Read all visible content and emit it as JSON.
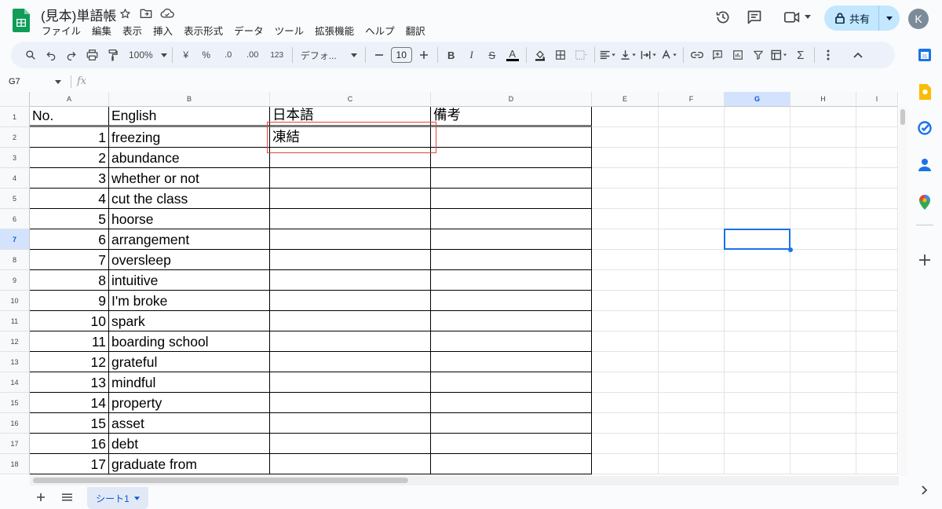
{
  "doc": {
    "title": "(見本)単語帳"
  },
  "menu": [
    "ファイル",
    "編集",
    "表示",
    "挿入",
    "表示形式",
    "データ",
    "ツール",
    "拡張機能",
    "ヘルプ",
    "翻訳"
  ],
  "header": {
    "share_label": "共有",
    "avatar_letter": "K"
  },
  "toolbar": {
    "zoom": "100%",
    "currency": "¥",
    "percent": "%",
    "dec_decrease": ".0",
    "dec_increase": ".00",
    "number_format": "123",
    "font": "デフォ...",
    "font_size": "10"
  },
  "formula_bar": {
    "cell_ref": "G7",
    "fx": "fx",
    "content": ""
  },
  "grid": {
    "columns": [
      "A",
      "B",
      "C",
      "D",
      "E",
      "F",
      "G",
      "H",
      "I"
    ],
    "selected_column": "G",
    "selected_row": "7",
    "rows": [
      {
        "row": "1",
        "a": "No.",
        "b": "English",
        "c": "日本語",
        "d": "備考"
      },
      {
        "row": "2",
        "a": "1",
        "b": "freezing",
        "c": "凍結",
        "d": ""
      },
      {
        "row": "3",
        "a": "2",
        "b": "abundance",
        "c": "",
        "d": ""
      },
      {
        "row": "4",
        "a": "3",
        "b": "whether or not",
        "c": "",
        "d": ""
      },
      {
        "row": "5",
        "a": "4",
        "b": "cut the class",
        "c": "",
        "d": ""
      },
      {
        "row": "6",
        "a": "5",
        "b": "hoorse",
        "c": "",
        "d": ""
      },
      {
        "row": "7",
        "a": "6",
        "b": "arrangement",
        "c": "",
        "d": ""
      },
      {
        "row": "8",
        "a": "7",
        "b": "oversleep",
        "c": "",
        "d": ""
      },
      {
        "row": "9",
        "a": "8",
        "b": "intuitive",
        "c": "",
        "d": ""
      },
      {
        "row": "10",
        "a": "9",
        "b": "I'm broke",
        "c": "",
        "d": ""
      },
      {
        "row": "11",
        "a": "10",
        "b": "spark",
        "c": "",
        "d": ""
      },
      {
        "row": "12",
        "a": "11",
        "b": "boarding school",
        "c": "",
        "d": ""
      },
      {
        "row": "13",
        "a": "12",
        "b": "grateful",
        "c": "",
        "d": ""
      },
      {
        "row": "14",
        "a": "13",
        "b": "mindful",
        "c": "",
        "d": ""
      },
      {
        "row": "15",
        "a": "14",
        "b": "property",
        "c": "",
        "d": ""
      },
      {
        "row": "16",
        "a": "15",
        "b": "asset",
        "c": "",
        "d": ""
      },
      {
        "row": "17",
        "a": "16",
        "b": "debt",
        "c": "",
        "d": ""
      },
      {
        "row": "18",
        "a": "17",
        "b": "graduate from",
        "c": "",
        "d": ""
      }
    ]
  },
  "sheets": {
    "active": "シート1"
  },
  "colors": {
    "selection": "#1a73e8",
    "annotation": "#e8453c",
    "share_bg": "#c2e7ff"
  }
}
